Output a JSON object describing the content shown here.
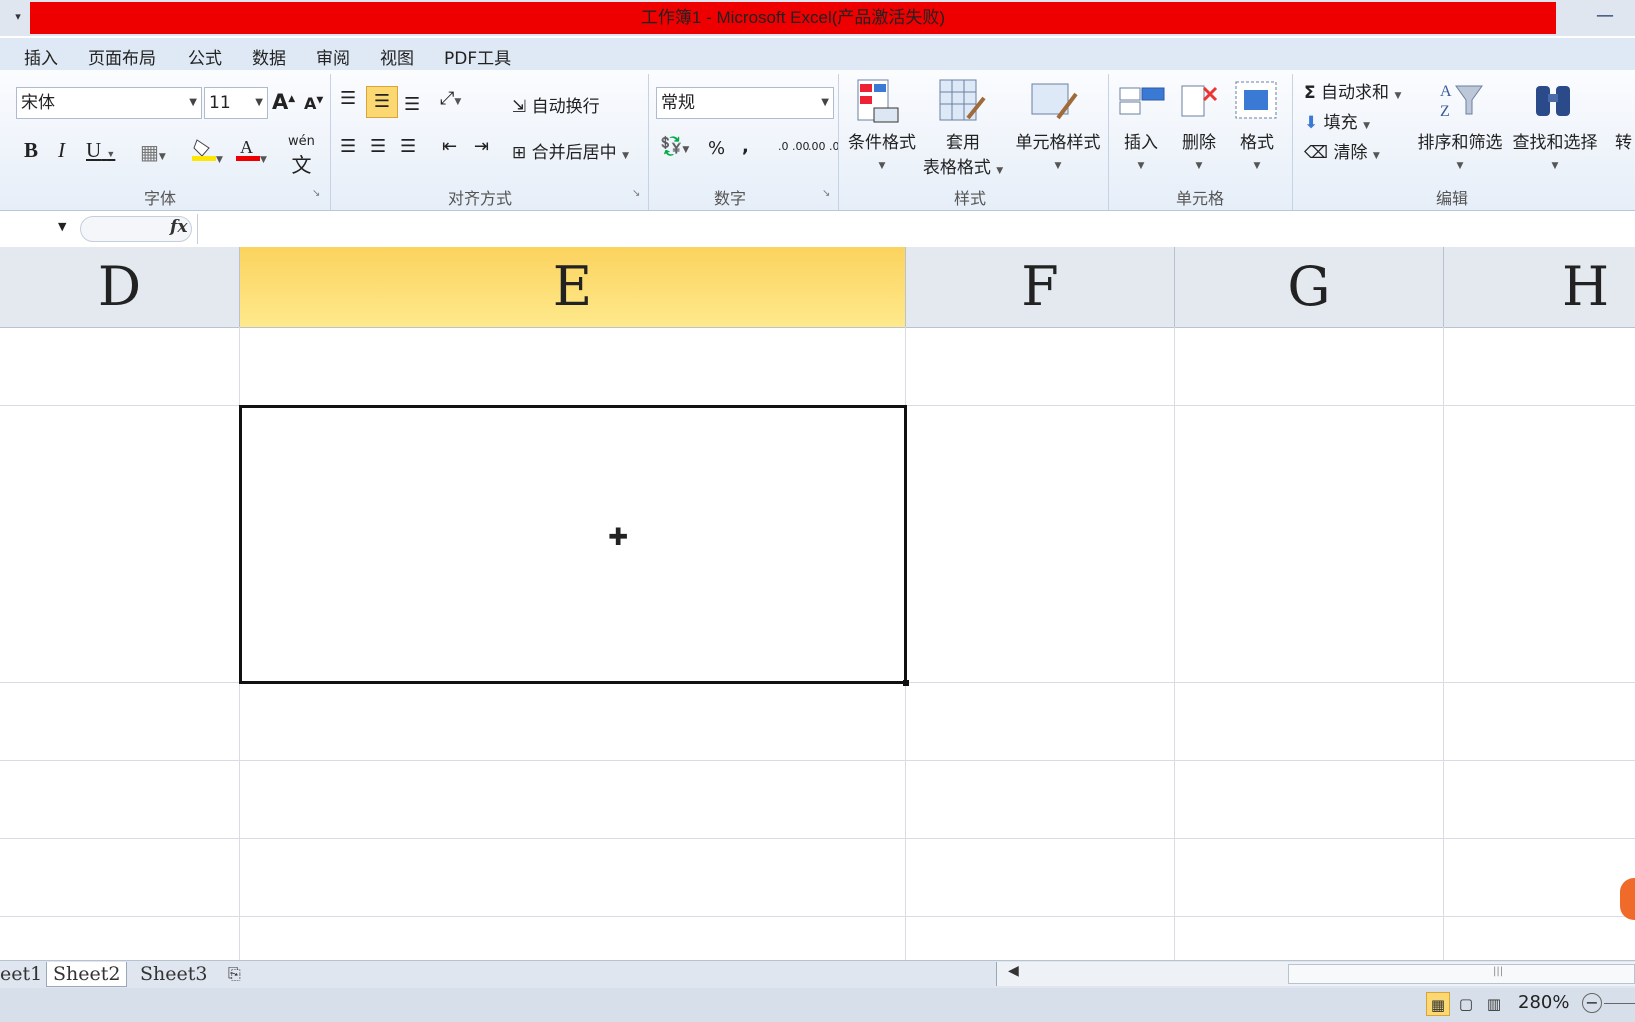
{
  "window": {
    "title": "工作簿1 - Microsoft Excel(产品激活失败)"
  },
  "ribbon_tabs": [
    "插入",
    "页面布局",
    "公式",
    "数据",
    "审阅",
    "视图",
    "PDF工具"
  ],
  "font_group": {
    "label": "字体",
    "font_name": "宋体",
    "font_size": "11",
    "bold": "B",
    "italic": "I",
    "underline": "U",
    "grow": "A",
    "shrink": "A",
    "phonetic": "wén"
  },
  "alignment_group": {
    "label": "对齐方式",
    "wrap_text": "自动换行",
    "merge_center": "合并后居中"
  },
  "number_group": {
    "label": "数字",
    "format": "常规",
    "percent": "%",
    "comma": ",",
    "inc_decimal": ".0 .00",
    "dec_decimal": ".00 .0"
  },
  "styles_group": {
    "label": "样式",
    "conditional": "条件格式",
    "table_format_1": "套用",
    "table_format_2": "表格格式",
    "cell_styles": "单元格样式"
  },
  "cells_group": {
    "label": "单元格",
    "insert": "插入",
    "delete": "删除",
    "format": "格式"
  },
  "editing_group": {
    "label": "编辑",
    "autosum": "自动求和",
    "sigma": "Σ",
    "fill": "填充",
    "clear": "清除",
    "sort_filter": "排序和筛选",
    "find_select": "查找和选择",
    "partial": "转"
  },
  "formula_bar": {
    "fx": "fx",
    "value": ""
  },
  "columns": [
    "D",
    "E",
    "F",
    "G",
    "H"
  ],
  "selected_column": "E",
  "sheets": [
    "eet1",
    "Sheet2",
    "Sheet3"
  ],
  "active_sheet": "Sheet2",
  "status": {
    "zoom": "280%"
  },
  "colors": {
    "title_bar": "#e00000",
    "selected_header": "#fbd35e",
    "ribbon": "#e6eef8"
  }
}
